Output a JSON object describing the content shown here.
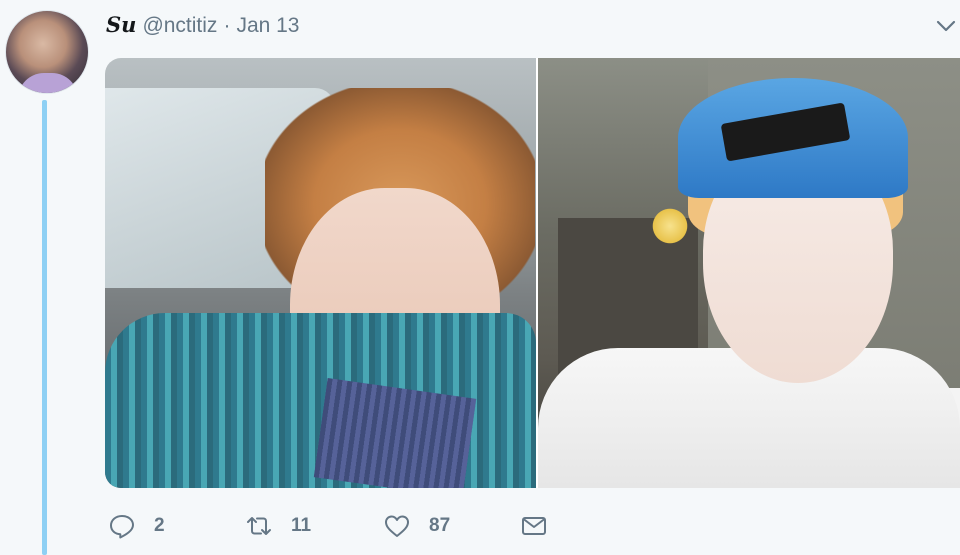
{
  "tweet": {
    "display_name": "Su",
    "handle": "@nctitiz",
    "separator": "·",
    "date": "Jan 13",
    "avatar_icon": "user-avatar",
    "menu_icon": "chevron-down-icon",
    "media": [
      {
        "icon": "photo-left"
      },
      {
        "icon": "photo-right"
      }
    ],
    "actions": {
      "reply_count": "2",
      "retweet_count": "11",
      "like_count": "87"
    },
    "colors": {
      "thread_line": "#8ed0f4",
      "text_secondary": "#657786",
      "background": "#f5f8fa"
    }
  }
}
